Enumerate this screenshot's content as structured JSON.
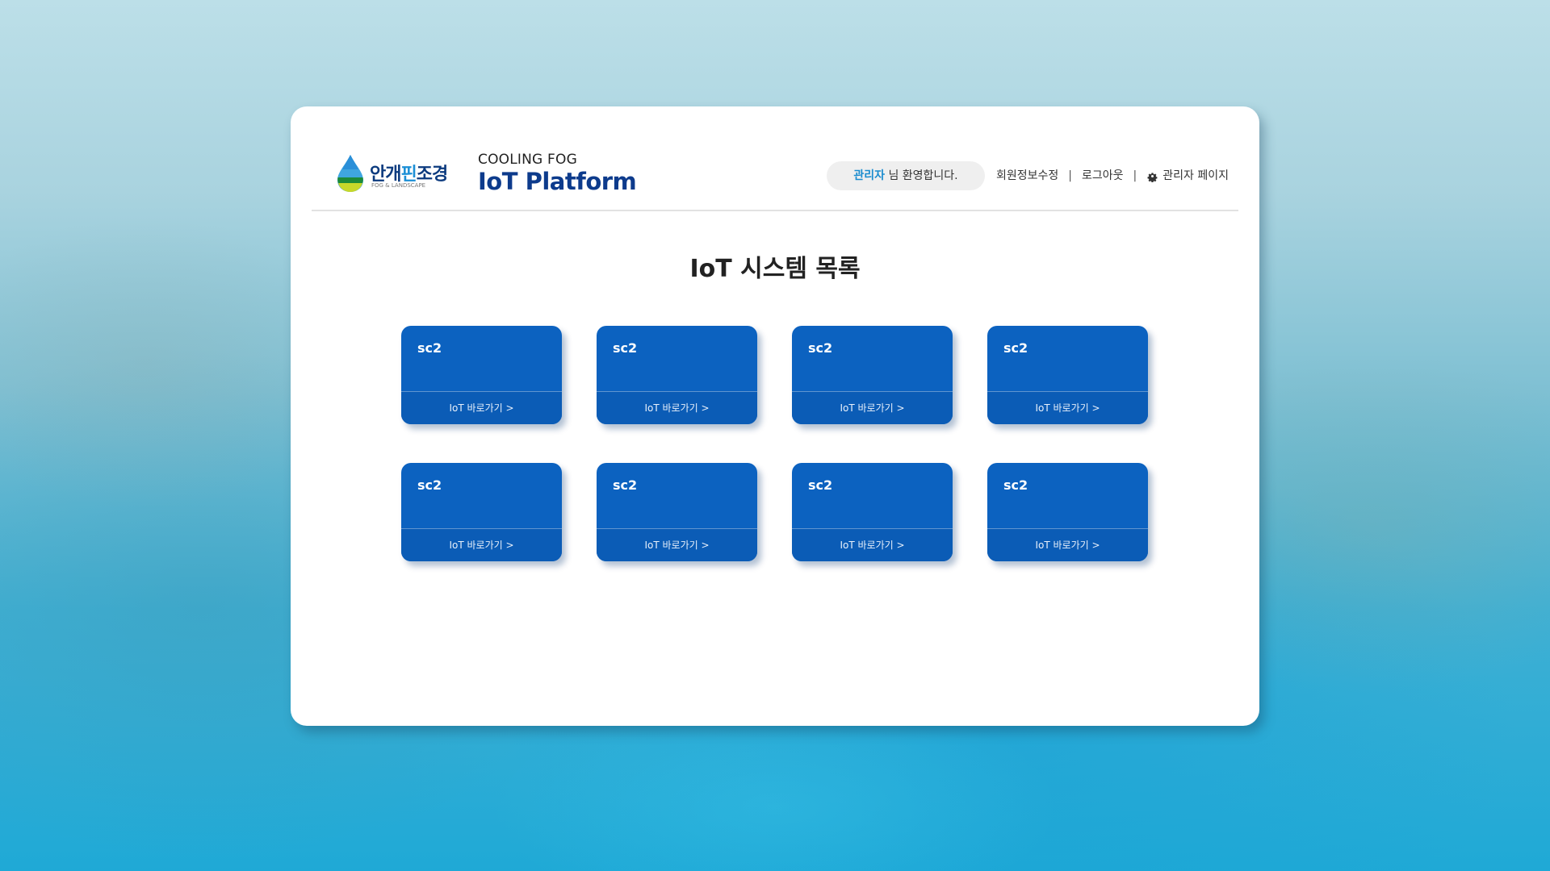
{
  "logo": {
    "title_part1": "안개",
    "title_part2": "핀",
    "title_part3": "조경",
    "subtitle": "FOG & LANDSCAPE"
  },
  "brand": {
    "small": "COOLING FOG",
    "big": "IoT Platform"
  },
  "header": {
    "welcome_user": "관리자",
    "welcome_text": " 님 환영합니다.",
    "nav_edit_profile": "회원정보수정",
    "nav_logout": "로그아웃",
    "nav_admin": "관리자 페이지",
    "separator": "|"
  },
  "main": {
    "title": "IoT 시스템 목록",
    "cards": [
      {
        "name": "sc2",
        "link_label": "IoT 바로가기  >"
      },
      {
        "name": "sc2",
        "link_label": "IoT 바로가기  >"
      },
      {
        "name": "sc2",
        "link_label": "IoT 바로가기  >"
      },
      {
        "name": "sc2",
        "link_label": "IoT 바로가기  >"
      },
      {
        "name": "sc2",
        "link_label": "IoT 바로가기  >"
      },
      {
        "name": "sc2",
        "link_label": "IoT 바로가기  >"
      },
      {
        "name": "sc2",
        "link_label": "IoT 바로가기  >"
      },
      {
        "name": "sc2",
        "link_label": "IoT 바로가기  >"
      }
    ]
  },
  "colors": {
    "card_blue": "#0c62c0",
    "brand_navy": "#0d3b8c",
    "user_accent": "#1a8ccf"
  }
}
